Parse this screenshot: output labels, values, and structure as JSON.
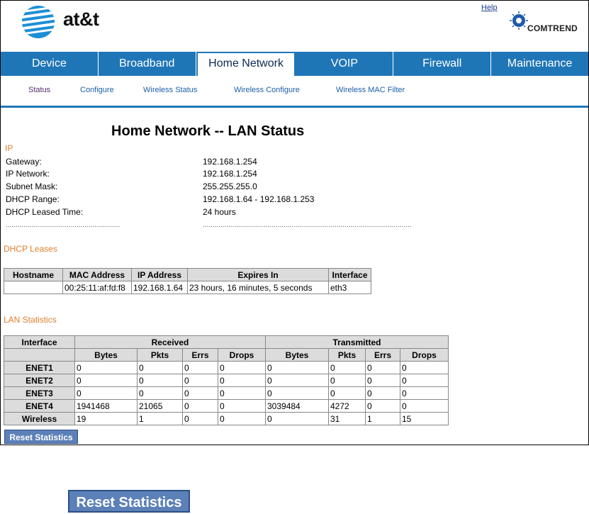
{
  "header": {
    "brand": "at&t",
    "help": "Help",
    "partner": "COMTREND"
  },
  "nav": [
    "Device",
    "Broadband",
    "Home Network",
    "VOIP",
    "Firewall",
    "Maintenance"
  ],
  "subnav": [
    "Status",
    "Configure",
    "Wireless Status",
    "Wireless Configure",
    "Wireless MAC Filter"
  ],
  "page_title": "Home Network -- LAN Status",
  "ip_section": {
    "title": "IP",
    "rows": [
      {
        "label": "Gateway:",
        "value": "192.168.1.254"
      },
      {
        "label": "IP Network:",
        "value": "192.168.1.254"
      },
      {
        "label": "Subnet Mask:",
        "value": "255.255.255.0"
      },
      {
        "label": "DHCP Range:",
        "value": "192.168.1.64 - 192.168.1.253"
      },
      {
        "label": "DHCP Leased Time:",
        "value": "24 hours"
      }
    ]
  },
  "dhcp": {
    "title": "DHCP Leases",
    "headers": [
      "Hostname",
      "MAC Address",
      "IP Address",
      "Expires In",
      "Interface"
    ],
    "row": [
      "",
      "00:25:11:af:fd:f8",
      "192.168.1.64",
      "23 hours, 16 minutes, 5 seconds",
      "eth3"
    ]
  },
  "lan": {
    "title": "LAN Statistics",
    "h_interface": "Interface",
    "h_received": "Received",
    "h_transmitted": "Transmitted",
    "sub": [
      "Bytes",
      "Pkts",
      "Errs",
      "Drops"
    ],
    "rows": [
      {
        "name": "ENET1",
        "vals": [
          "0",
          "0",
          "0",
          "0",
          "0",
          "0",
          "0",
          "0"
        ]
      },
      {
        "name": "ENET2",
        "vals": [
          "0",
          "0",
          "0",
          "0",
          "0",
          "0",
          "0",
          "0"
        ]
      },
      {
        "name": "ENET3",
        "vals": [
          "0",
          "0",
          "0",
          "0",
          "0",
          "0",
          "0",
          "0"
        ]
      },
      {
        "name": "ENET4",
        "vals": [
          "1941468",
          "21065",
          "0",
          "0",
          "3039484",
          "4272",
          "0",
          "0"
        ]
      },
      {
        "name": "Wireless",
        "vals": [
          "19",
          "1",
          "0",
          "0",
          "0",
          "31",
          "1",
          "15"
        ]
      }
    ]
  },
  "reset_label": "Reset Statistics"
}
